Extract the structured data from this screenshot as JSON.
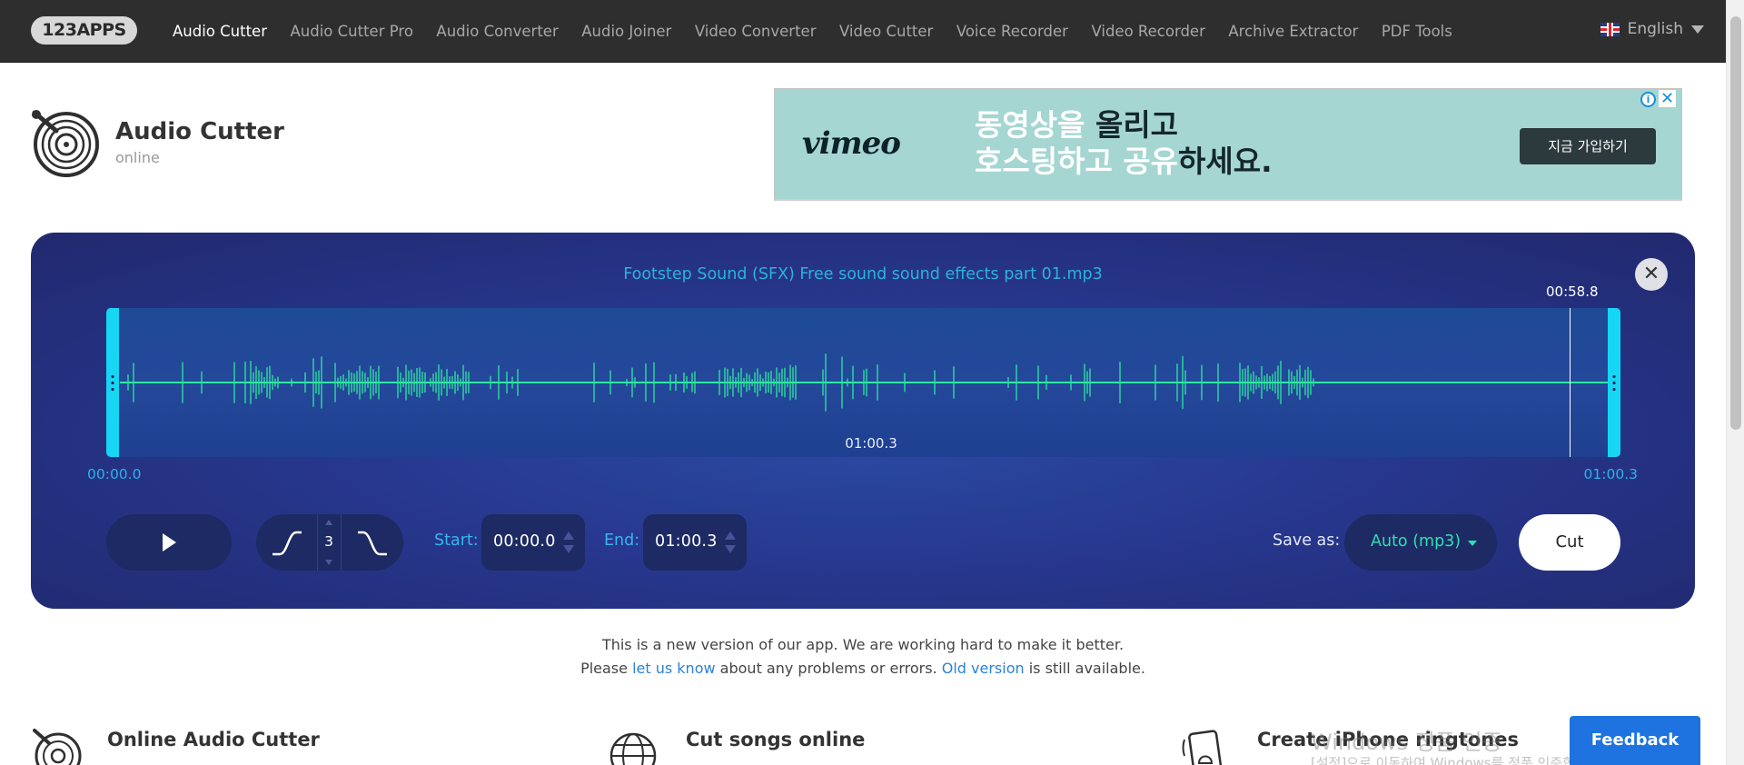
{
  "nav": {
    "logo": "123APPS",
    "items": [
      {
        "label": "Audio Cutter",
        "active": true
      },
      {
        "label": "Audio Cutter Pro",
        "active": false
      },
      {
        "label": "Audio Converter",
        "active": false
      },
      {
        "label": "Audio Joiner",
        "active": false
      },
      {
        "label": "Video Converter",
        "active": false
      },
      {
        "label": "Video Cutter",
        "active": false
      },
      {
        "label": "Voice Recorder",
        "active": false
      },
      {
        "label": "Video Recorder",
        "active": false
      },
      {
        "label": "Archive Extractor",
        "active": false
      },
      {
        "label": "PDF Tools",
        "active": false
      }
    ],
    "language": "English"
  },
  "header": {
    "title": "Audio Cutter",
    "subtitle": "online"
  },
  "ad": {
    "brand": "vimeo",
    "line1_white": "동영상을",
    "line1_dark": "올리고",
    "line2_white": "호스팅하고 공유",
    "line2_dark": "하세요.",
    "button": "지금 가입하기"
  },
  "editor": {
    "file_name": "Footstep Sound (SFX) Free sound sound effects part 01.mp3",
    "playhead_time": "00:58.8",
    "center_time": "01:00.3",
    "range_start_label": "00:00.0",
    "range_end_label": "01:00.3",
    "fade_value": "3",
    "start_label": "Start:",
    "start_value": "00:00.0",
    "end_label": "End:",
    "end_value": "01:00.3",
    "save_as_label": "Save as:",
    "format": "Auto (mp3)",
    "cut_label": "Cut",
    "wave_color": "#2ee8a0",
    "handle_color": "#16d6f3"
  },
  "notice": {
    "line1": "This is a new version of our app. We are working hard to make it better.",
    "line2_a": "Please",
    "link1": "let us know",
    "line2_b": "about any problems or errors.",
    "link2": "Old version",
    "line2_c": "is still available."
  },
  "features": [
    {
      "title": "Online Audio Cutter",
      "icon": "vinyl-icon"
    },
    {
      "title": "Cut songs online",
      "icon": "globe-icon"
    },
    {
      "title": "Create iPhone ringtones",
      "icon": "phone-bell-icon"
    }
  ],
  "watermark": {
    "line1": "Windows 정품 인증",
    "line2": "[설정]으로 이동하여 Windows를 정품 인증합니다."
  },
  "feedback": "Feedback"
}
